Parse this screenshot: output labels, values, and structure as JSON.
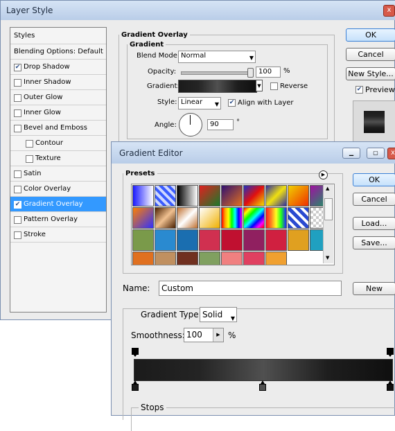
{
  "layer_style": {
    "title": "Layer Style",
    "close_glyph": "x",
    "styles_header": "Styles",
    "style_items": [
      {
        "label": "Blending Options: Default",
        "checkbox": false,
        "checked": false,
        "indent": false,
        "selected": false
      },
      {
        "label": "Drop Shadow",
        "checkbox": true,
        "checked": true,
        "indent": false,
        "selected": false
      },
      {
        "label": "Inner Shadow",
        "checkbox": true,
        "checked": false,
        "indent": false,
        "selected": false
      },
      {
        "label": "Outer Glow",
        "checkbox": true,
        "checked": false,
        "indent": false,
        "selected": false
      },
      {
        "label": "Inner Glow",
        "checkbox": true,
        "checked": false,
        "indent": false,
        "selected": false
      },
      {
        "label": "Bevel and Emboss",
        "checkbox": true,
        "checked": false,
        "indent": false,
        "selected": false
      },
      {
        "label": "Contour",
        "checkbox": true,
        "checked": false,
        "indent": true,
        "selected": false
      },
      {
        "label": "Texture",
        "checkbox": true,
        "checked": false,
        "indent": true,
        "selected": false
      },
      {
        "label": "Satin",
        "checkbox": true,
        "checked": false,
        "indent": false,
        "selected": false
      },
      {
        "label": "Color Overlay",
        "checkbox": true,
        "checked": false,
        "indent": false,
        "selected": false
      },
      {
        "label": "Gradient Overlay",
        "checkbox": true,
        "checked": true,
        "indent": false,
        "selected": true
      },
      {
        "label": "Pattern Overlay",
        "checkbox": true,
        "checked": false,
        "indent": false,
        "selected": false
      },
      {
        "label": "Stroke",
        "checkbox": true,
        "checked": false,
        "indent": false,
        "selected": false
      }
    ],
    "section_title": "Gradient Overlay",
    "group_title": "Gradient",
    "blend_mode_label": "Blend Mode:",
    "blend_mode_value": "Normal",
    "opacity_label": "Opacity:",
    "opacity_value": "100",
    "opacity_fraction": 1.0,
    "percent_sign": "%",
    "gradient_label": "Gradient:",
    "reverse_label": "Reverse",
    "reverse_checked": false,
    "style_label": "Style:",
    "style_value": "Linear",
    "align_label": "Align with Layer",
    "align_checked": true,
    "angle_label": "Angle:",
    "angle_value": "90",
    "degree_sign": "°",
    "ok_label": "OK",
    "cancel_label": "Cancel",
    "new_style_label": "New Style...",
    "preview_label": "Preview",
    "preview_checked": true
  },
  "gradient_editor": {
    "title": "Gradient Editor",
    "presets_label": "Presets",
    "ok_label": "OK",
    "cancel_label": "Cancel",
    "load_label": "Load...",
    "save_label": "Save...",
    "name_label": "Name:",
    "name_value": "Custom",
    "new_label": "New",
    "gradient_type_label": "Gradient Type:",
    "gradient_type_value": "Solid",
    "smoothness_label": "Smoothness:",
    "smoothness_value": "100",
    "smoothness_unit": "%",
    "stops_label": "Stops",
    "gradient_colors": [
      "#1b1b1b",
      "#242424",
      "#505050",
      "#1e1e1e",
      "#0f0f0f"
    ],
    "swatches": [
      "linear-gradient(90deg,#1a1aff,#ffffff)",
      "repeating-linear-gradient(45deg,#3a5cff 0 4px,#cfd8ff 4px 8px)",
      "linear-gradient(90deg,#000,#fff)",
      "linear-gradient(135deg,#e02020,#1a7a2a)",
      "linear-gradient(135deg,#301070,#e07020)",
      "linear-gradient(135deg,#2030c0,#e01010,#f0e000)",
      "linear-gradient(135deg,#3030a0,#f0e010,#3030a0)",
      "linear-gradient(135deg,#f0d000,#f03000)",
      "linear-gradient(135deg,#a010a0,#10a060)",
      "linear-gradient(135deg,#ff8000,#3030ff)",
      "linear-gradient(135deg,#4a2000,#f0c090,#4a2000)",
      "linear-gradient(135deg,#c07030,#ffffff,#c07030)",
      "linear-gradient(135deg,#ffffff,#f0b000)",
      "linear-gradient(90deg,red,orange,yellow,lime,cyan,blue,magenta)",
      "linear-gradient(135deg,red,yellow,lime,cyan,blue,magenta,red)",
      "linear-gradient(90deg,#ff2020,#ff8020,#ffff20,#20ff20,#2020ff)",
      "repeating-linear-gradient(45deg,#2a4ad0 0 5px,#ffffff 5px 9px)",
      "repeating-conic-gradient(#cccccc 0 25%,#ffffff 0 50%) 0 0/8px 8px",
      "#7a9a4a",
      "#2a8ad0",
      "#1a6eb0",
      "#d03050",
      "#c01030",
      "#902060",
      "#d02040",
      "#e0a020",
      "#20a0c0",
      "#e07020",
      "#c09060",
      "#703020",
      "#80a060",
      "#f08080",
      "#e04060",
      "#f0a030"
    ]
  }
}
